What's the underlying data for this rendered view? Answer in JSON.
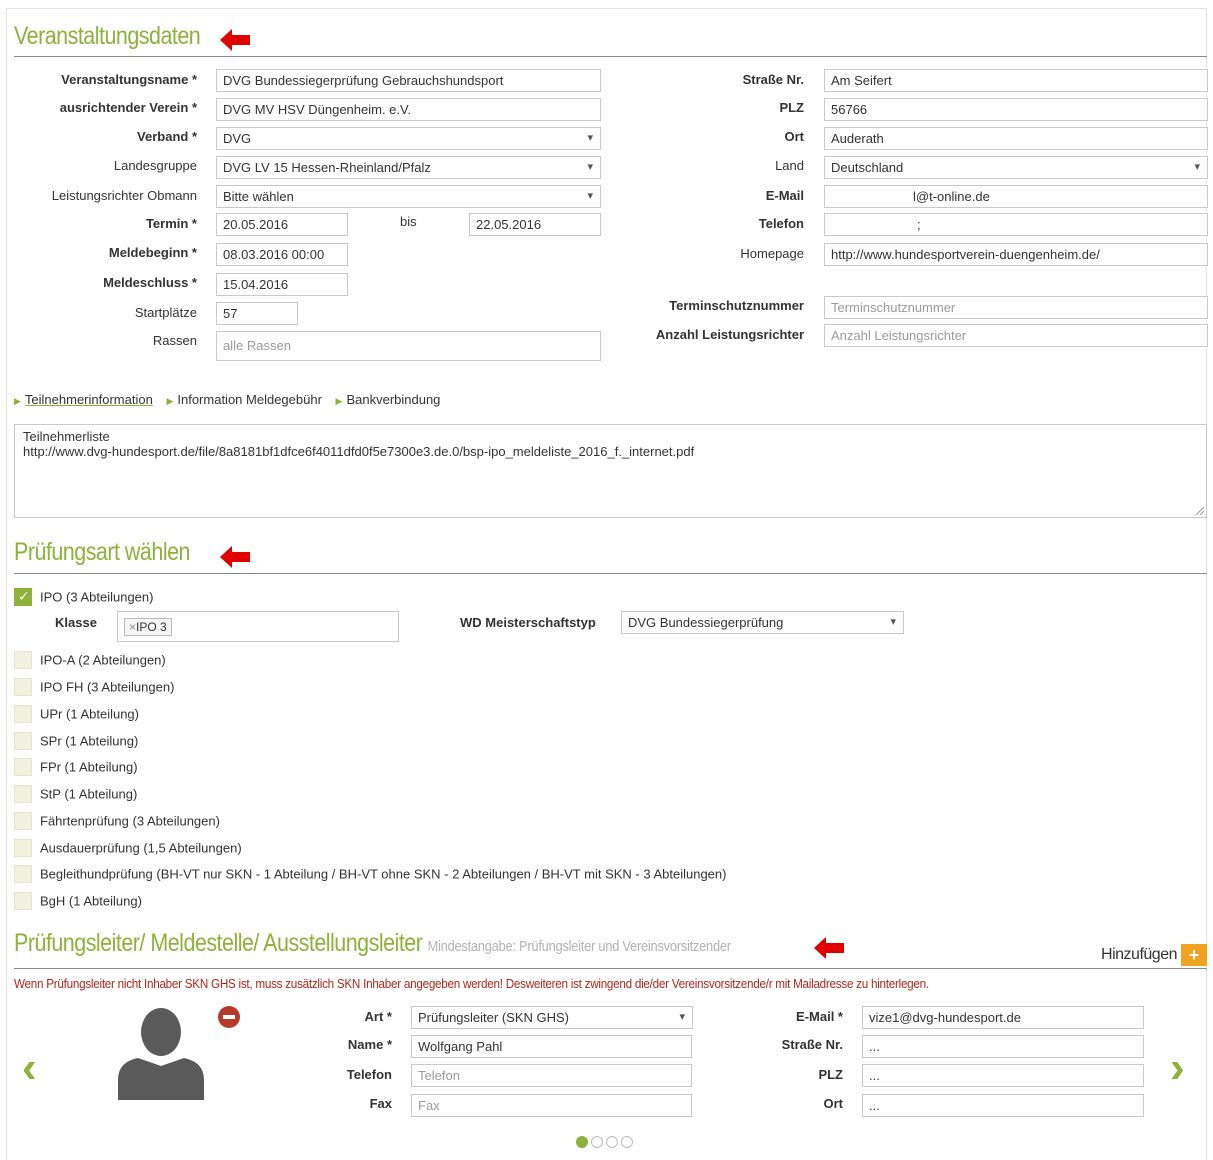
{
  "sections": {
    "event": "Veranstaltungsdaten",
    "exam": "Prüfungsart wählen",
    "people": "Prüfungsleiter/ Meldestelle/ Ausstellungsleiter",
    "people_sub": "Mindestangabe: Prüfungsleiter und Vereinsvorsitzender"
  },
  "event_left": {
    "name": {
      "label": "Veranstaltungsname *",
      "value": "DVG Bundessiegerprüfung Gebrauchshundsport"
    },
    "club": {
      "label": "ausrichtender Verein *",
      "value": "DVG MV HSV Düngenheim. e.V."
    },
    "association": {
      "label": "Verband *",
      "value": "DVG"
    },
    "region": {
      "label": "Landesgruppe",
      "value": "DVG LV 15 Hessen-Rheinland/Pfalz"
    },
    "judge": {
      "label": "Leistungsrichter Obmann",
      "value": "Bitte wählen"
    },
    "date": {
      "label": "Termin *",
      "from": "20.05.2016",
      "to_label": "bis",
      "to": "22.05.2016"
    },
    "reg_start": {
      "label": "Meldebeginn *",
      "value": "08.03.2016 00:00"
    },
    "reg_end": {
      "label": "Meldeschluss *",
      "value": "15.04.2016"
    },
    "slots": {
      "label": "Startplätze",
      "value": "57"
    },
    "breeds": {
      "label": "Rassen",
      "placeholder": "alle Rassen"
    }
  },
  "event_right": {
    "street": {
      "label": "Straße Nr.",
      "value": "Am Seifert"
    },
    "zip": {
      "label": "PLZ",
      "value": "56766"
    },
    "city": {
      "label": "Ort",
      "value": "Auderath"
    },
    "country": {
      "label": "Land",
      "value": "Deutschland"
    },
    "email": {
      "label": "E-Mail",
      "value": "l@t-online.de"
    },
    "phone": {
      "label": "Telefon",
      "value": ";"
    },
    "homepage": {
      "label": "Homepage",
      "value": "http://www.hundesportverein-duengenheim.de/"
    },
    "protection": {
      "label": "Terminschutznummer",
      "placeholder": "Terminschutznummer"
    },
    "judge_count": {
      "label": "Anzahl Leistungsrichter",
      "placeholder": "Anzahl Leistungsrichter"
    }
  },
  "tabs": [
    "Teilnehmerinformation",
    "Information Meldegebühr",
    "Bankverbindung"
  ],
  "info_text": {
    "line1": "Teilnehmerliste",
    "line2": "http://www.dvg-hundesport.de/file/8a8181bf1dfce6f4011dfd0f5e7300e3.de.0/bsp-ipo_meldeliste_2016_f._internet.pdf"
  },
  "exam": {
    "ipo": "IPO (3 Abteilungen)",
    "class_label": "Klasse",
    "class_tag": "IPO 3",
    "tag_remove": "×",
    "wd_label": "WD Meisterschaftstyp",
    "wd_value": "DVG Bundessiegerprüfung",
    "options": [
      "IPO-A (2 Abteilungen)",
      "IPO FH (3 Abteilungen)",
      "UPr (1 Abteilung)",
      "SPr (1 Abteilung)",
      "FPr (1 Abteilung)",
      "StP (1 Abteilung)",
      "Fährtenprüfung (3 Abteilungen)",
      "Ausdauerprüfung (1,5 Abteilungen)",
      "Begleithundprüfung (BH-VT nur SKN - 1 Abteilung / BH-VT ohne SKN - 2 Abteilungen / BH-VT mit SKN - 3 Abteilungen)",
      "BgH (1 Abteilung)"
    ]
  },
  "people": {
    "add_label": "Hinzufügen",
    "add_icon": "+",
    "warning": "Wenn Prüfungsleiter nicht Inhaber SKN GHS ist, muss zusätzlich SKN Inhaber angegeben werden! Desweiteren ist zwingend die/der Vereinsvorsitzende/r mit Mailadresse zu hinterlegen.",
    "art": {
      "label": "Art *",
      "value": "Prüfungsleiter (SKN GHS)"
    },
    "name": {
      "label": "Name *",
      "value": "Wolfgang Pahl"
    },
    "phone": {
      "label": "Telefon",
      "placeholder": "Telefon"
    },
    "fax": {
      "label": "Fax",
      "placeholder": "Fax"
    },
    "email": {
      "label": "E-Mail *",
      "value": "vize1@dvg-hundesport.de"
    },
    "street": {
      "label": "Straße Nr.",
      "value": "..."
    },
    "zip": {
      "label": "PLZ",
      "value": "..."
    },
    "city": {
      "label": "Ort",
      "value": "..."
    },
    "prev_icon": "‹",
    "next_icon": "›"
  },
  "colors": {
    "accent": "#8cb23a",
    "warning": "#b3261e",
    "add": "#f0a321",
    "arrow": "#e00000"
  }
}
